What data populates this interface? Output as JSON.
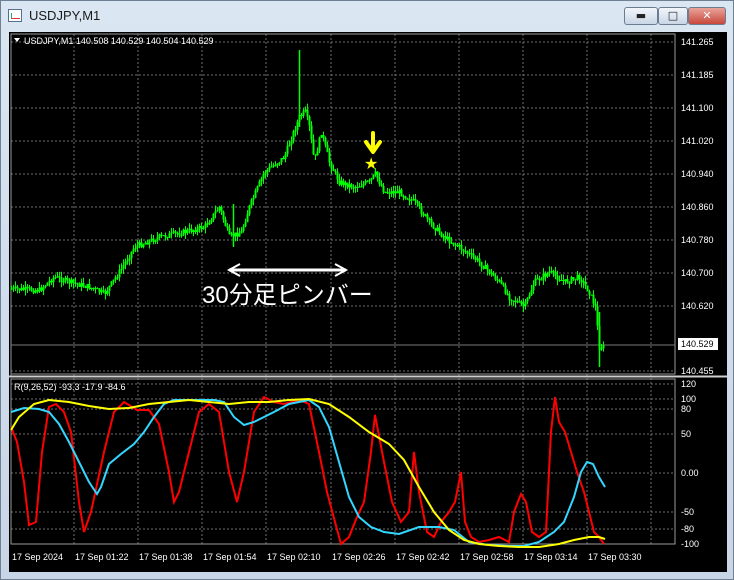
{
  "window": {
    "title": "USDJPY,M1",
    "min_icon": "minimize-icon",
    "max_icon": "maximize-icon",
    "close_icon": "close-icon"
  },
  "colors": {
    "background": "#000000",
    "grid": "#6f6f6f",
    "candle": "#00ff00",
    "axis_text": "#ffffff",
    "annotation_arrow": "#ffff00",
    "fast_line": "#ff0000",
    "mid_line": "#33d6ff",
    "slow_line": "#ffff00"
  },
  "main_chart": {
    "header": "USDJPY,M1  140.508 140.529 140.504 140.529",
    "price_ticks": [
      "141.265",
      "141.185",
      "141.100",
      "141.020",
      "140.940",
      "140.860",
      "140.780",
      "140.700",
      "140.620",
      "140.455"
    ],
    "current_price": "140.529",
    "annotation_text": "30分足ピンバー",
    "star_icon": "star-icon",
    "arrow_icon": "down-arrow-icon"
  },
  "indicator": {
    "header": "R(9,26,52) -93.3 -17.9 -84.6",
    "ticks": [
      "120",
      "100",
      "80",
      "50",
      "0.00",
      "-50",
      "-80",
      "-100"
    ]
  },
  "time_axis": [
    "17 Sep 2024",
    "17 Sep 01:22",
    "17 Sep 01:38",
    "17 Sep 01:54",
    "17 Sep 02:10",
    "17 Sep 02:26",
    "17 Sep 02:42",
    "17 Sep 02:58",
    "17 Sep 03:14",
    "17 Sep 03:30"
  ],
  "chart_data": {
    "type": "line",
    "title": "USDJPY,M1",
    "xlabel": "",
    "ylabel": "",
    "x": [
      "17 Sep 2024",
      "17 Sep 01:22",
      "17 Sep 01:38",
      "17 Sep 01:54",
      "17 Sep 02:10",
      "17 Sep 02:26",
      "17 Sep 02:42",
      "17 Sep 02:58",
      "17 Sep 03:14",
      "17 Sep 03:30"
    ],
    "ylim": [
      140.455,
      141.265
    ],
    "series": [
      {
        "name": "USDJPY,M1",
        "values": [
          140.66,
          140.69,
          140.75,
          140.82,
          140.97,
          140.92,
          140.86,
          140.74,
          140.63,
          140.68
        ]
      }
    ],
    "indicator": {
      "ylim": [
        -120,
        120
      ],
      "series": [
        {
          "name": "R(9)",
          "values": [
            -60,
            90,
            100,
            85,
            100,
            40,
            -85,
            -75,
            90,
            -93.3
          ]
        },
        {
          "name": "R(26)",
          "values": [
            70,
            60,
            85,
            95,
            95,
            90,
            -80,
            -90,
            -90,
            -17.9
          ]
        },
        {
          "name": "R(52)",
          "values": [
            60,
            100,
            90,
            95,
            98,
            99,
            20,
            -95,
            -98,
            -84.6
          ]
        }
      ]
    }
  }
}
